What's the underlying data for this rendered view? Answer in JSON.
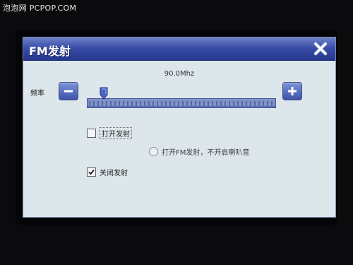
{
  "watermark": "泡泡网 PCPOP.COM",
  "dialog": {
    "title": "FM发射",
    "close_icon": "close-x-icon",
    "title_colors": {
      "top": "#6d80c8",
      "bottom": "#24378d"
    }
  },
  "frequency": {
    "value_text": "90.0Mhz",
    "label": "频率",
    "minus_icon": "minus-icon",
    "plus_icon": "plus-icon",
    "slider_position": 0.09
  },
  "options": [
    {
      "label": "打开发射",
      "type": "checkbox",
      "checked": false
    },
    {
      "label": "打开FM发射，不开启喇叭音",
      "type": "radio",
      "checked": false,
      "disabled": true
    },
    {
      "label": "关闭发射",
      "type": "checkbox",
      "checked": true
    }
  ]
}
